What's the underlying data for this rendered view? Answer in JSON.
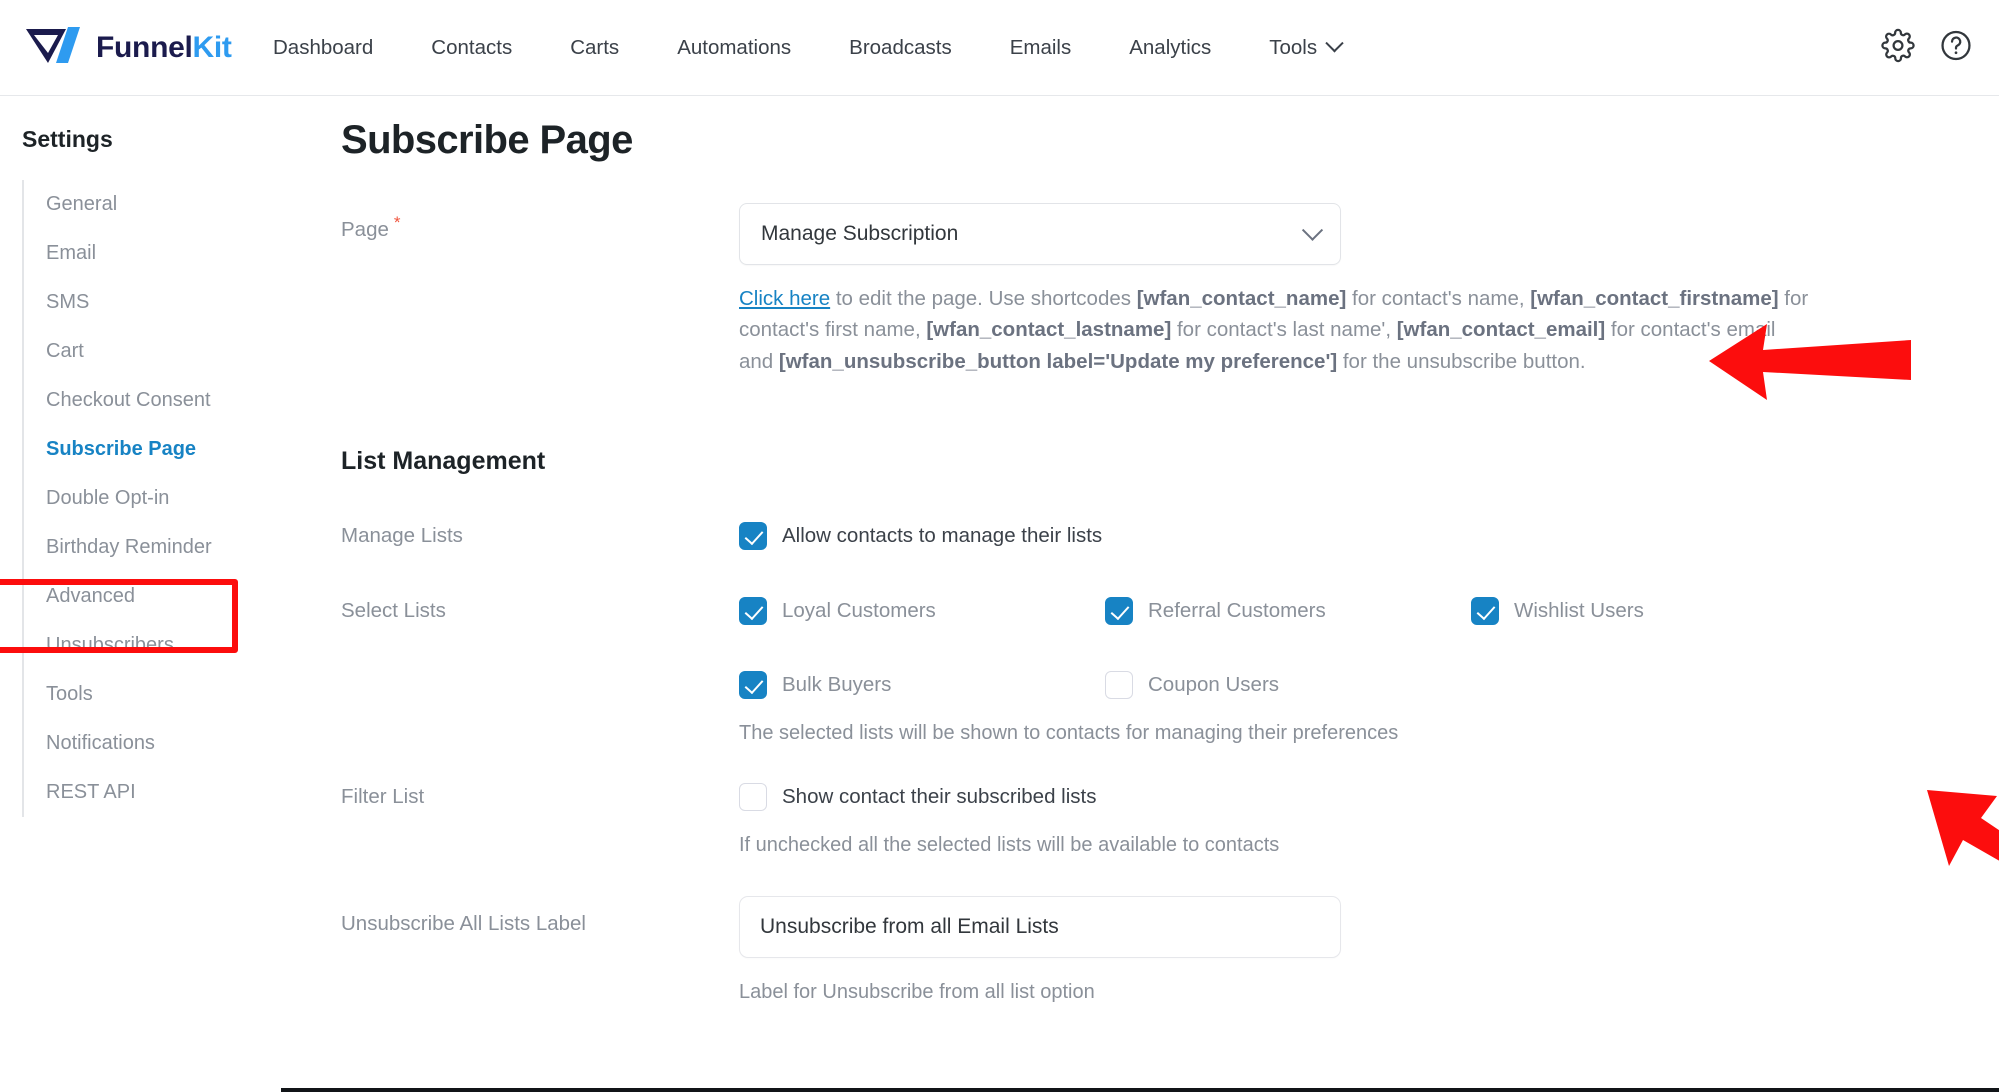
{
  "brand": {
    "name_first": "Funnel",
    "name_second": "Kit",
    "logo_icon": "funnelkit-logo-icon"
  },
  "topnav": {
    "items": [
      {
        "label": "Dashboard",
        "has_caret": false
      },
      {
        "label": "Contacts",
        "has_caret": false
      },
      {
        "label": "Carts",
        "has_caret": false
      },
      {
        "label": "Automations",
        "has_caret": false
      },
      {
        "label": "Broadcasts",
        "has_caret": false
      },
      {
        "label": "Emails",
        "has_caret": false
      },
      {
        "label": "Analytics",
        "has_caret": false
      },
      {
        "label": "Tools",
        "has_caret": true
      }
    ],
    "settings_icon": "gear-icon",
    "help_icon": "question-circle-icon"
  },
  "sidebar": {
    "title": "Settings",
    "items": [
      {
        "label": "General",
        "active": false
      },
      {
        "label": "Email",
        "active": false
      },
      {
        "label": "SMS",
        "active": false
      },
      {
        "label": "Cart",
        "active": false
      },
      {
        "label": "Checkout Consent",
        "active": false
      },
      {
        "label": "Subscribe Page",
        "active": true
      },
      {
        "label": "Double Opt-in",
        "active": false
      },
      {
        "label": "Birthday Reminder",
        "active": false
      },
      {
        "label": "Advanced",
        "active": false
      },
      {
        "label": "Unsubscribers",
        "active": false
      },
      {
        "label": "Tools",
        "active": false
      },
      {
        "label": "Notifications",
        "active": false
      },
      {
        "label": "REST API",
        "active": false
      }
    ]
  },
  "main": {
    "page_title": "Subscribe Page",
    "page_field": {
      "label": "Page",
      "required_marker": "*",
      "selected_value": "Manage Subscription",
      "chevron_icon": "chevron-down-icon"
    },
    "help": {
      "link_text": "Click here",
      "part1": " to edit the page. Use shortcodes ",
      "code1": "[wfan_contact_name]",
      "part2": " for contact's name, ",
      "code2": "[wfan_contact_firstname]",
      "part3": " for contact's first name, ",
      "code3": "[wfan_contact_lastname]",
      "part4": " for contact's last name', ",
      "code4": "[wfan_contact_email]",
      "part5": " for contact's email and ",
      "code5": "[wfan_unsubscribe_button label='Update my preference']",
      "part6": " for the unsubscribe button."
    },
    "list_management": {
      "heading": "List Management",
      "manage_lists": {
        "label": "Manage Lists",
        "checkbox_label": "Allow contacts to manage their lists",
        "checked": true
      },
      "select_lists": {
        "label": "Select Lists",
        "options": [
          {
            "label": "Loyal Customers",
            "checked": true
          },
          {
            "label": "Referral Customers",
            "checked": true
          },
          {
            "label": "Wishlist Users",
            "checked": true
          },
          {
            "label": "Bulk Buyers",
            "checked": true
          },
          {
            "label": "Coupon Users",
            "checked": false
          }
        ],
        "note": "The selected lists will be shown to contacts for managing their preferences"
      },
      "filter_list": {
        "label": "Filter List",
        "checkbox_label": "Show contact their subscribed lists",
        "checked": false,
        "note": "If unchecked all the selected lists will be available to contacts"
      },
      "unsubscribe_all": {
        "label": "Unsubscribe All Lists Label",
        "value": "Unsubscribe from all Email Lists",
        "placeholder": "Unsubscribe from all Email Lists",
        "note": "Label for Unsubscribe from all list option"
      }
    }
  },
  "annotations": {
    "highlight_color": "#fc0d0d",
    "arrow_color": "#fc0d0d",
    "arrows": [
      {
        "name": "arrow-pointing-to-page-dropdown",
        "direction": "left"
      },
      {
        "name": "arrow-pointing-to-select-lists",
        "direction": "up-left"
      }
    ]
  },
  "colors": {
    "accent_blue": "#1783c4",
    "brand_navy": "#1b1b4d",
    "brand_blue": "#2e9bf0",
    "muted_text": "#8a9099",
    "dark_text": "#1d2327"
  }
}
